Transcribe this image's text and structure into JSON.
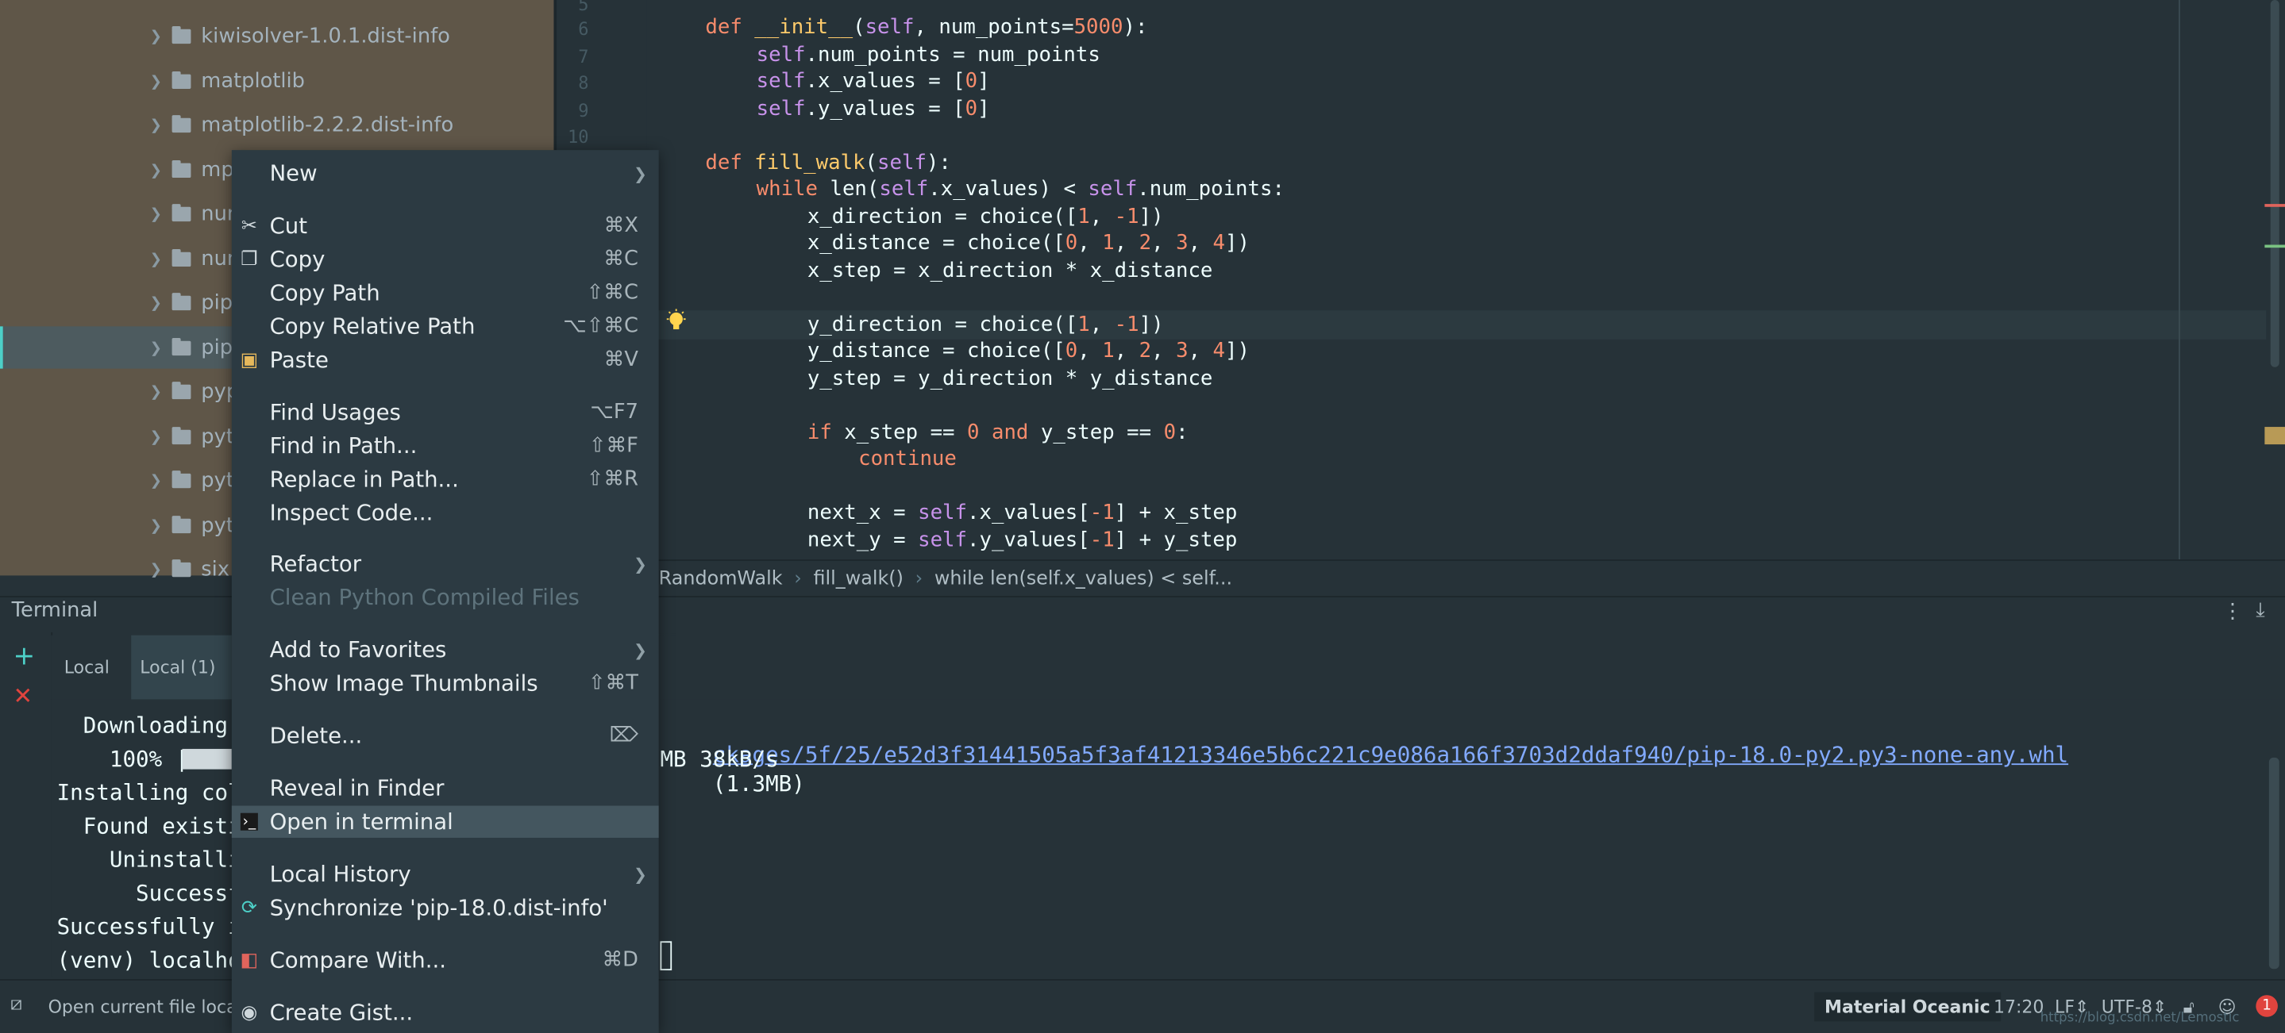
{
  "project_tree": {
    "items": [
      {
        "label": "kiwisolver-1.0.1.dist-info"
      },
      {
        "label": "matplotlib"
      },
      {
        "label": "matplotlib-2.2.2.dist-info"
      },
      {
        "label": "mpl"
      },
      {
        "label": "num"
      },
      {
        "label": "num"
      },
      {
        "label": "pip"
      },
      {
        "label": "pip"
      },
      {
        "label": "pyp"
      },
      {
        "label": "pyth"
      },
      {
        "label": "pytz"
      },
      {
        "label": "pytz"
      },
      {
        "label": "six"
      }
    ]
  },
  "editor": {
    "line_numbers": [
      "5",
      "6",
      "7",
      "8",
      "9",
      "10"
    ],
    "lines": [
      "def __init__(self, num_points=5000):",
      "self.num_points = num_points",
      "self.x_values = [0]",
      "self.y_values = [0]",
      "",
      "def fill_walk(self):",
      "while len(self.x_values) < self.num_points:",
      "x_direction = choice([1, -1])",
      "x_distance = choice([0, 1, 2, 3, 4])",
      "x_step = x_direction * x_distance",
      "",
      "y_direction = choice([1, -1])",
      "y_distance = choice([0, 1, 2, 3, 4])",
      "y_step = y_direction * y_distance",
      "",
      "if x_step == 0 and y_step == 0:",
      "continue",
      "",
      "next_x = self.x_values[-1] + x_step",
      "next_y = self.y_values[-1] + y_step"
    ]
  },
  "breadcrumb": {
    "items": [
      "RandomWalk",
      "fill_walk()",
      "while len(self.x_values) < self..."
    ]
  },
  "terminal": {
    "title": "Terminal",
    "tabs": [
      "Local",
      "Local (1)"
    ],
    "lines": [
      "  Downloading",
      "    100% |",
      "Installing col",
      "  Found existi",
      "    Uninstalli",
      "      Successf",
      "Successfully i",
      "(venv) localho"
    ],
    "download_url": "ckages/5f/25/e52d3f31441505a5f3af41213346e5b6c221c9e086a166f3703d2ddaf940/pip-18.0-py2.py3-none-any.whl",
    "download_size": "(1.3MB)",
    "progress_text": "MB 38kB/s"
  },
  "context_menu": {
    "items": [
      {
        "label": "New",
        "shortcut": "",
        "submenu": true
      },
      {
        "label": "Cut",
        "shortcut": "⌘X",
        "icon": "scissors-icon"
      },
      {
        "label": "Copy",
        "shortcut": "⌘C",
        "icon": "copy-icon"
      },
      {
        "label": "Copy Path",
        "shortcut": "⇧⌘C"
      },
      {
        "label": "Copy Relative Path",
        "shortcut": "⌥⇧⌘C"
      },
      {
        "label": "Paste",
        "shortcut": "⌘V",
        "icon": "paste-icon"
      },
      {
        "label": "Find Usages",
        "shortcut": "⌥F7"
      },
      {
        "label": "Find in Path...",
        "shortcut": "⇧⌘F"
      },
      {
        "label": "Replace in Path...",
        "shortcut": "⇧⌘R"
      },
      {
        "label": "Inspect Code...",
        "shortcut": ""
      },
      {
        "label": "Refactor",
        "shortcut": "",
        "submenu": true
      },
      {
        "label": "Clean Python Compiled Files",
        "shortcut": "",
        "disabled": true
      },
      {
        "label": "Add to Favorites",
        "shortcut": "",
        "submenu": true
      },
      {
        "label": "Show Image Thumbnails",
        "shortcut": "⇧⌘T"
      },
      {
        "label": "Delete...",
        "shortcut": "⌦"
      },
      {
        "label": "Reveal in Finder",
        "shortcut": ""
      },
      {
        "label": "Open in terminal",
        "shortcut": "",
        "icon": "terminal-icon",
        "selected": true
      },
      {
        "label": "Local History",
        "shortcut": "",
        "submenu": true
      },
      {
        "label": "Synchronize 'pip-18.0.dist-info'",
        "shortcut": "",
        "icon": "sync-icon"
      },
      {
        "label": "Compare With...",
        "shortcut": "⌘D",
        "icon": "compare-icon"
      },
      {
        "label": "Create Gist...",
        "shortcut": "",
        "icon": "github-icon"
      }
    ]
  },
  "statusbar": {
    "message": "Open current file locati",
    "theme": "Material Oceanic",
    "position": "17:20",
    "line_separator": "LF",
    "encoding": "UTF-8",
    "notifications": "1",
    "watermark": "https://blog.csdn.net/Lemostic"
  },
  "colors": {
    "editor_bg": "#263238",
    "tree_bg": "#5f5648",
    "menu_bg": "#2c3a42",
    "menu_selected": "#44565f",
    "accent": "#4dd0c8"
  }
}
